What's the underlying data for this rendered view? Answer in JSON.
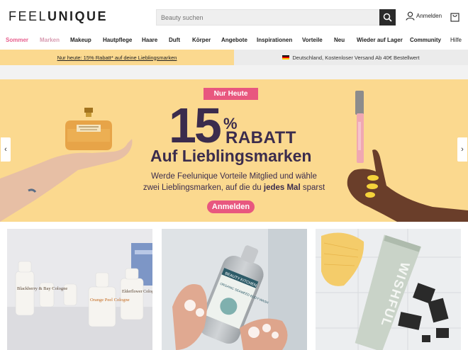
{
  "header": {
    "logo_light": "FEEL",
    "logo_bold": "UNIQUE",
    "search_placeholder": "Beauty suchen",
    "signin_label": "Anmelden"
  },
  "nav": {
    "items": [
      "Sommer",
      "Marken",
      "Makeup",
      "Hautpflege",
      "Haare",
      "Duft",
      "Körper",
      "Angebote",
      "Inspirationen",
      "Vorteile",
      "Neu",
      "Wieder auf Lager",
      "Community",
      "Hilfe"
    ]
  },
  "promo": {
    "left": "Nur heute: 15% Rabatt* auf deine Lieblingsmarken",
    "right": "Deutschland, Kostenloser Versand Ab 40€ Bestellwert"
  },
  "hero": {
    "badge": "Nur Heute",
    "percent": "15",
    "percent_sign": "%",
    "rabatt": "RABATT",
    "subtitle": "Auf Lieblingsmarken",
    "body_line1": "Werde Feelunique Vorteile Mitglied und wähle",
    "body_line2_pre": "zwei Lieblingsmarken, auf die du ",
    "body_line2_bold": "jedes Mal",
    "body_line2_post": " sparst",
    "cta": "Anmelden",
    "colors": {
      "background": "#fbd98f",
      "accent": "#e8577f",
      "text": "#3b2c4d"
    }
  },
  "tiles": {
    "tile1": {
      "bottle_labels": [
        "Blackberry & Bay Cologne",
        "Orange Peel Cologne",
        "Elderflower Cologne"
      ]
    },
    "tile2": {
      "bottle_brand": "BEAUTY KITCHEN",
      "bottle_label": "ORGANIC SEAWEED BODY WASH"
    },
    "tile3": {
      "tube_brand": "WISHFUL"
    }
  }
}
